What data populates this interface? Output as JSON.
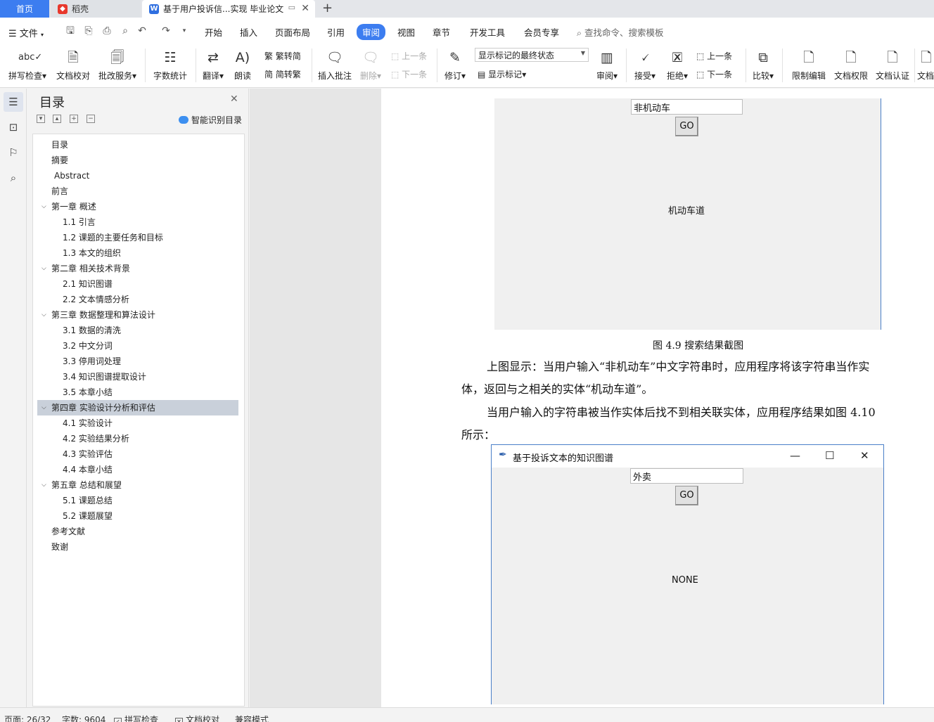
{
  "tabs": {
    "home": "首页",
    "daoke": "稻壳",
    "doc": "基于用户投诉信...实现 毕业论文",
    "add": "+"
  },
  "menu": {
    "file": "文件",
    "tabs": [
      "开始",
      "插入",
      "页面布局",
      "引用",
      "审阅",
      "视图",
      "章节",
      "开发工具",
      "会员专享"
    ],
    "active_tab": "审阅",
    "search": "查找命令、搜索模板"
  },
  "ribbon": {
    "spell_check": "拼写检查",
    "doc_proof": "文档校对",
    "review_service": "批改服务",
    "word_count": "字数统计",
    "translate": "翻译",
    "read_aloud": "朗读",
    "trad_to_simp": "繁转简",
    "simp_to_trad": "简转繁",
    "insert_comment": "插入批注",
    "delete": "删除",
    "prev": "上一条",
    "next": "下一条",
    "track_changes": "修订",
    "markup_state": "显示标记的最终状态",
    "show_markup": "显示标记",
    "review": "审阅",
    "accept": "接受",
    "reject": "拒绝",
    "prev2": "上一条",
    "next2": "下一条",
    "compare": "比较",
    "restrict_edit": "限制编辑",
    "doc_rights": "文档权限",
    "doc_cert": "文档认证",
    "doc_more": "文档"
  },
  "toc": {
    "title": "目录",
    "smart": "智能识别目录",
    "items": [
      {
        "text": "目录",
        "level": 0,
        "chevron": false
      },
      {
        "text": "摘要",
        "level": 0,
        "chevron": false
      },
      {
        "text": "Abstract",
        "level": 0,
        "chevron": false,
        "indent_extra": true
      },
      {
        "text": "前言",
        "level": 0,
        "chevron": false
      },
      {
        "text": "第一章  概述",
        "level": 0,
        "chevron": true
      },
      {
        "text": "1.1 引言",
        "level": 1
      },
      {
        "text": "1.2  课题的主要任务和目标",
        "level": 1
      },
      {
        "text": "1.3 本文的组织",
        "level": 1
      },
      {
        "text": "第二章  相关技术背景",
        "level": 0,
        "chevron": true
      },
      {
        "text": "2.1  知识图谱",
        "level": 1
      },
      {
        "text": "2.2 文本情感分析",
        "level": 1
      },
      {
        "text": "第三章  数据整理和算法设计",
        "level": 0,
        "chevron": true
      },
      {
        "text": "3.1 数据的清洗",
        "level": 1
      },
      {
        "text": "3.2 中文分词",
        "level": 1
      },
      {
        "text": "3.3 停用词处理",
        "level": 1
      },
      {
        "text": "3.4 知识图谱提取设计",
        "level": 1
      },
      {
        "text": "3.5 本章小结",
        "level": 1
      },
      {
        "text": "第四章  实验设计分析和评估",
        "level": 0,
        "chevron": true,
        "selected": true
      },
      {
        "text": "4.1 实验设计",
        "level": 1
      },
      {
        "text": "4.2 实验结果分析",
        "level": 1
      },
      {
        "text": "4.3 实验评估",
        "level": 1
      },
      {
        "text": "4.4 本章小结",
        "level": 1
      },
      {
        "text": "第五章  总结和展望",
        "level": 0,
        "chevron": true
      },
      {
        "text": "5.1 课题总结",
        "level": 1
      },
      {
        "text": "5.2 课题展望",
        "level": 1
      },
      {
        "text": "参考文献",
        "level": 0,
        "chevron": false
      },
      {
        "text": "致谢",
        "level": 0,
        "chevron": false
      }
    ]
  },
  "document": {
    "shot1": {
      "input": "非机动车",
      "button": "GO",
      "result": "机动车道"
    },
    "caption": "图 4.9 搜索结果截图",
    "para1_line1": "上图显示：当用户输入“非机动车”中文字符串时，应用程序将该字符串当作实",
    "para1_line2": "体，返回与之相关的实体“机动车道”。",
    "para2_line1": "当用户输入的字符串被当作实体后找不到相关联实体，应用程序结果如图 4.10",
    "para2_line2": "所示：",
    "shot2": {
      "title": "基于投诉文本的知识图谱",
      "minimize": "—",
      "maximize": "☐",
      "close": "✕",
      "input": "外卖",
      "button": "GO",
      "result": "NONE"
    }
  },
  "status": {
    "page": "页面: 26/32",
    "words": "字数: 9604",
    "spell": "拼写检查",
    "proof": "文档校对",
    "compat": "兼容模式"
  },
  "colors": {
    "accent": "#3c7df0",
    "selected_toc": "#c9d0da",
    "window_border": "#4a7fc8"
  }
}
